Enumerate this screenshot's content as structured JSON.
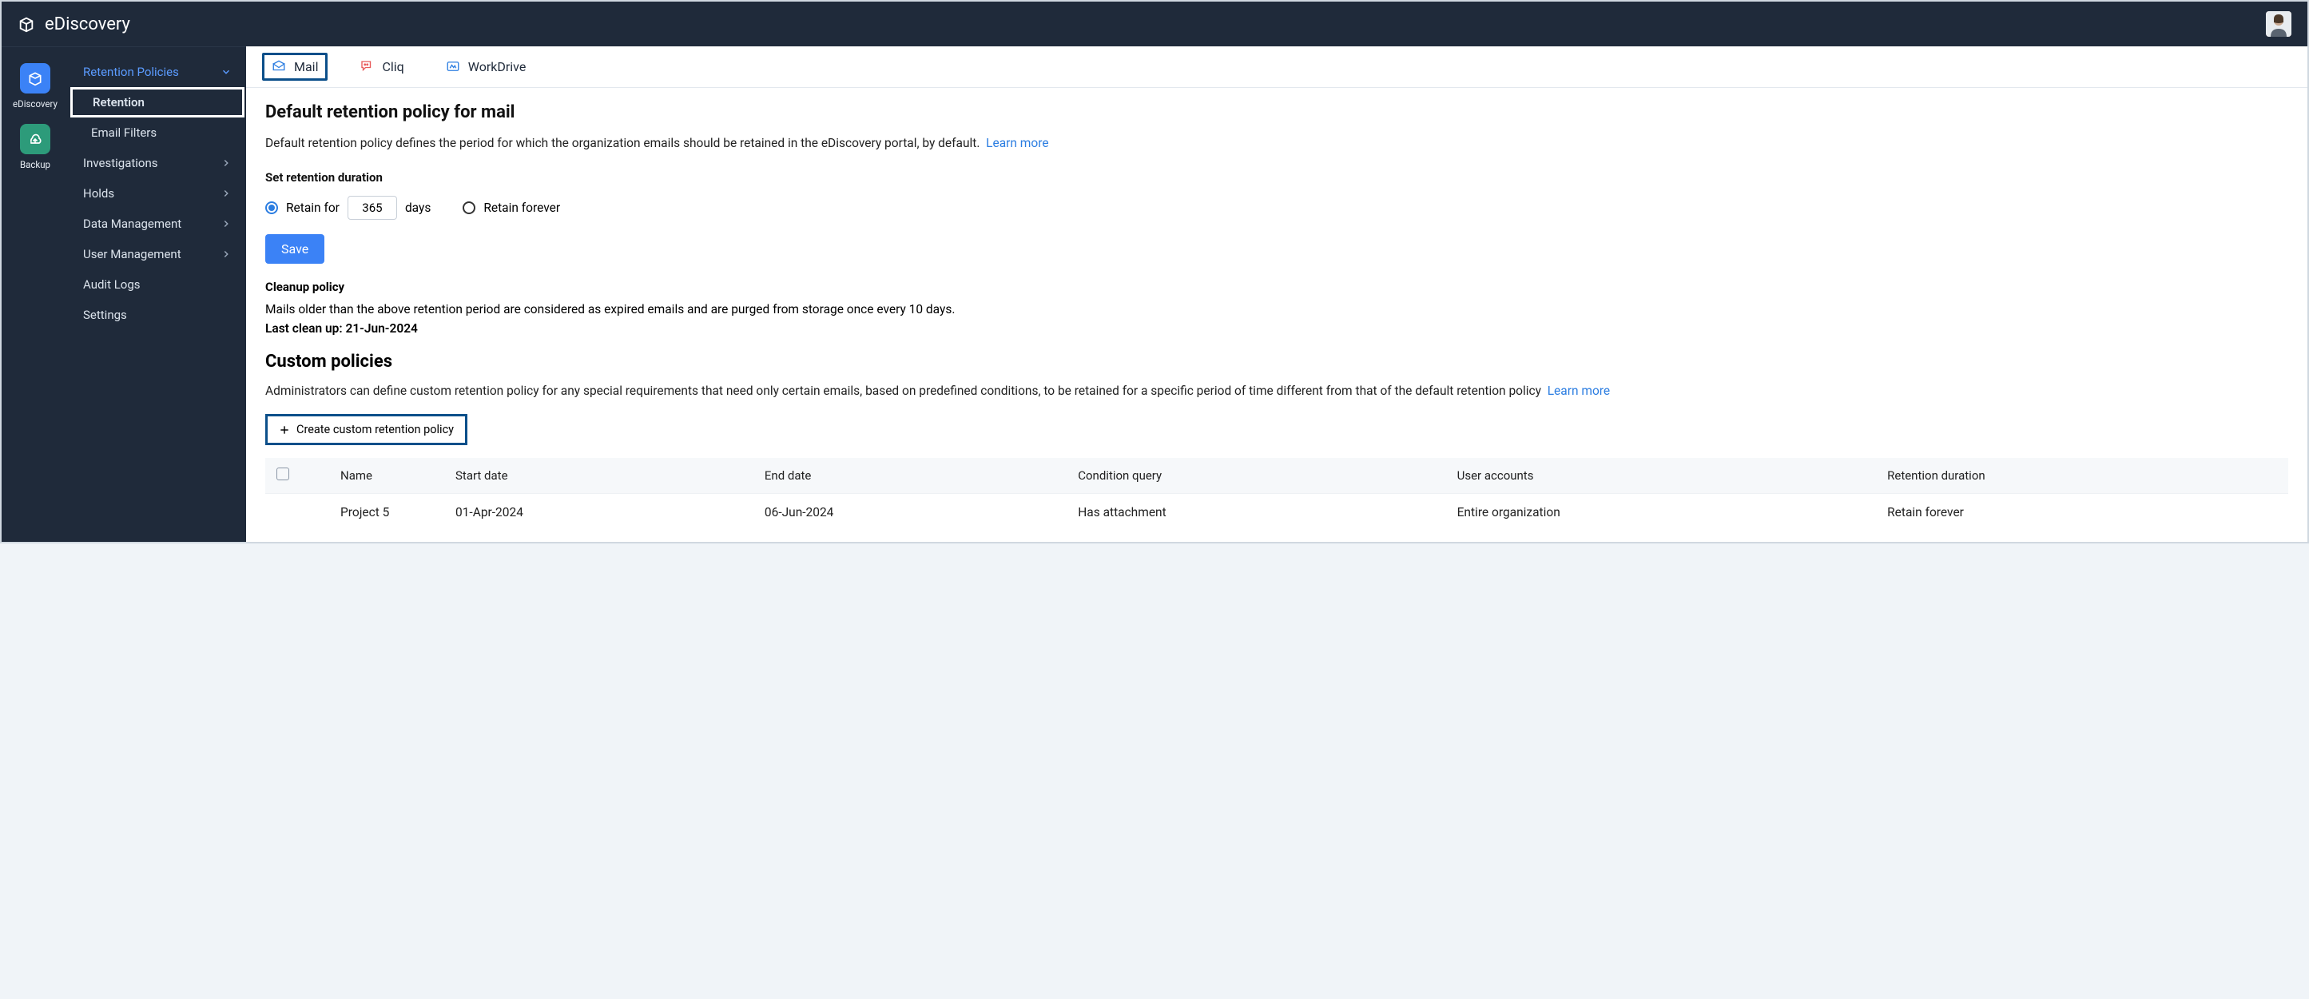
{
  "app": {
    "title": "eDiscovery"
  },
  "rail": {
    "items": [
      {
        "label": "eDiscovery",
        "active": true
      },
      {
        "label": "Backup",
        "active": false
      }
    ]
  },
  "sidebar": {
    "items": [
      {
        "label": "Retention Policies",
        "expanded": true,
        "children": [
          {
            "label": "Retention",
            "active": true
          },
          {
            "label": "Email Filters"
          }
        ]
      },
      {
        "label": "Investigations"
      },
      {
        "label": "Holds"
      },
      {
        "label": "Data Management"
      },
      {
        "label": "User Management"
      },
      {
        "label": "Audit Logs",
        "no_chevron": true
      },
      {
        "label": "Settings",
        "no_chevron": true
      }
    ]
  },
  "tabs": [
    {
      "label": "Mail",
      "active": true
    },
    {
      "label": "Cliq"
    },
    {
      "label": "WorkDrive"
    }
  ],
  "default_policy": {
    "title": "Default retention policy for mail",
    "desc": "Default retention policy defines the period for which the organization emails should be retained in the eDiscovery portal, by default.",
    "learn_more": "Learn more",
    "duration_label": "Set retention duration",
    "retain_for_label": "Retain for",
    "days_value": "365",
    "days_suffix": "days",
    "retain_forever_label": "Retain forever",
    "save_label": "Save",
    "cleanup_title": "Cleanup policy",
    "cleanup_desc": "Mails older than the above retention period are considered as expired emails and are purged from storage once every 10 days.",
    "last_cleanup": "Last clean up: 21-Jun-2024"
  },
  "custom": {
    "title": "Custom policies",
    "desc": "Administrators can define custom retention policy for any special requirements that need only certain emails, based on predefined conditions, to be retained for a specific period of time different from that of the default retention policy",
    "learn_more": "Learn more",
    "create_label": "Create custom retention policy",
    "columns": [
      "Name",
      "Start date",
      "End date",
      "Condition query",
      "User accounts",
      "Retention duration"
    ],
    "rows": [
      {
        "name": "Project 5",
        "start": "01-Apr-2024",
        "end": "06-Jun-2024",
        "cond": "Has attachment",
        "users": "Entire organization",
        "duration": "Retain forever"
      }
    ]
  }
}
